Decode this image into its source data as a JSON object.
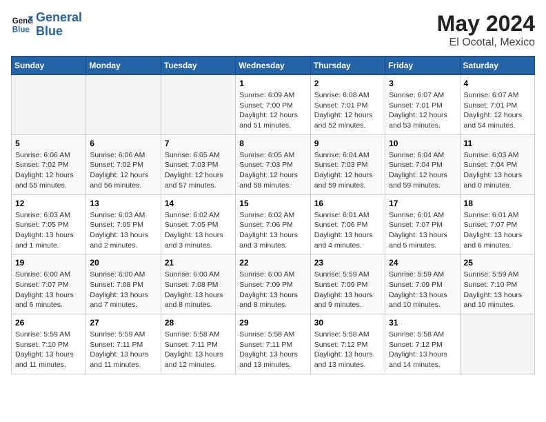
{
  "header": {
    "logo_line1": "General",
    "logo_line2": "Blue",
    "month_year": "May 2024",
    "location": "El Ocotal, Mexico"
  },
  "weekdays": [
    "Sunday",
    "Monday",
    "Tuesday",
    "Wednesday",
    "Thursday",
    "Friday",
    "Saturday"
  ],
  "weeks": [
    [
      {
        "day": "",
        "sunrise": "",
        "sunset": "",
        "daylight": ""
      },
      {
        "day": "",
        "sunrise": "",
        "sunset": "",
        "daylight": ""
      },
      {
        "day": "",
        "sunrise": "",
        "sunset": "",
        "daylight": ""
      },
      {
        "day": "1",
        "sunrise": "Sunrise: 6:09 AM",
        "sunset": "Sunset: 7:00 PM",
        "daylight": "Daylight: 12 hours and 51 minutes."
      },
      {
        "day": "2",
        "sunrise": "Sunrise: 6:08 AM",
        "sunset": "Sunset: 7:01 PM",
        "daylight": "Daylight: 12 hours and 52 minutes."
      },
      {
        "day": "3",
        "sunrise": "Sunrise: 6:07 AM",
        "sunset": "Sunset: 7:01 PM",
        "daylight": "Daylight: 12 hours and 53 minutes."
      },
      {
        "day": "4",
        "sunrise": "Sunrise: 6:07 AM",
        "sunset": "Sunset: 7:01 PM",
        "daylight": "Daylight: 12 hours and 54 minutes."
      }
    ],
    [
      {
        "day": "5",
        "sunrise": "Sunrise: 6:06 AM",
        "sunset": "Sunset: 7:02 PM",
        "daylight": "Daylight: 12 hours and 55 minutes."
      },
      {
        "day": "6",
        "sunrise": "Sunrise: 6:06 AM",
        "sunset": "Sunset: 7:02 PM",
        "daylight": "Daylight: 12 hours and 56 minutes."
      },
      {
        "day": "7",
        "sunrise": "Sunrise: 6:05 AM",
        "sunset": "Sunset: 7:03 PM",
        "daylight": "Daylight: 12 hours and 57 minutes."
      },
      {
        "day": "8",
        "sunrise": "Sunrise: 6:05 AM",
        "sunset": "Sunset: 7:03 PM",
        "daylight": "Daylight: 12 hours and 58 minutes."
      },
      {
        "day": "9",
        "sunrise": "Sunrise: 6:04 AM",
        "sunset": "Sunset: 7:03 PM",
        "daylight": "Daylight: 12 hours and 59 minutes."
      },
      {
        "day": "10",
        "sunrise": "Sunrise: 6:04 AM",
        "sunset": "Sunset: 7:04 PM",
        "daylight": "Daylight: 12 hours and 59 minutes."
      },
      {
        "day": "11",
        "sunrise": "Sunrise: 6:03 AM",
        "sunset": "Sunset: 7:04 PM",
        "daylight": "Daylight: 13 hours and 0 minutes."
      }
    ],
    [
      {
        "day": "12",
        "sunrise": "Sunrise: 6:03 AM",
        "sunset": "Sunset: 7:05 PM",
        "daylight": "Daylight: 13 hours and 1 minute."
      },
      {
        "day": "13",
        "sunrise": "Sunrise: 6:03 AM",
        "sunset": "Sunset: 7:05 PM",
        "daylight": "Daylight: 13 hours and 2 minutes."
      },
      {
        "day": "14",
        "sunrise": "Sunrise: 6:02 AM",
        "sunset": "Sunset: 7:05 PM",
        "daylight": "Daylight: 13 hours and 3 minutes."
      },
      {
        "day": "15",
        "sunrise": "Sunrise: 6:02 AM",
        "sunset": "Sunset: 7:06 PM",
        "daylight": "Daylight: 13 hours and 3 minutes."
      },
      {
        "day": "16",
        "sunrise": "Sunrise: 6:01 AM",
        "sunset": "Sunset: 7:06 PM",
        "daylight": "Daylight: 13 hours and 4 minutes."
      },
      {
        "day": "17",
        "sunrise": "Sunrise: 6:01 AM",
        "sunset": "Sunset: 7:07 PM",
        "daylight": "Daylight: 13 hours and 5 minutes."
      },
      {
        "day": "18",
        "sunrise": "Sunrise: 6:01 AM",
        "sunset": "Sunset: 7:07 PM",
        "daylight": "Daylight: 13 hours and 6 minutes."
      }
    ],
    [
      {
        "day": "19",
        "sunrise": "Sunrise: 6:00 AM",
        "sunset": "Sunset: 7:07 PM",
        "daylight": "Daylight: 13 hours and 6 minutes."
      },
      {
        "day": "20",
        "sunrise": "Sunrise: 6:00 AM",
        "sunset": "Sunset: 7:08 PM",
        "daylight": "Daylight: 13 hours and 7 minutes."
      },
      {
        "day": "21",
        "sunrise": "Sunrise: 6:00 AM",
        "sunset": "Sunset: 7:08 PM",
        "daylight": "Daylight: 13 hours and 8 minutes."
      },
      {
        "day": "22",
        "sunrise": "Sunrise: 6:00 AM",
        "sunset": "Sunset: 7:09 PM",
        "daylight": "Daylight: 13 hours and 8 minutes."
      },
      {
        "day": "23",
        "sunrise": "Sunrise: 5:59 AM",
        "sunset": "Sunset: 7:09 PM",
        "daylight": "Daylight: 13 hours and 9 minutes."
      },
      {
        "day": "24",
        "sunrise": "Sunrise: 5:59 AM",
        "sunset": "Sunset: 7:09 PM",
        "daylight": "Daylight: 13 hours and 10 minutes."
      },
      {
        "day": "25",
        "sunrise": "Sunrise: 5:59 AM",
        "sunset": "Sunset: 7:10 PM",
        "daylight": "Daylight: 13 hours and 10 minutes."
      }
    ],
    [
      {
        "day": "26",
        "sunrise": "Sunrise: 5:59 AM",
        "sunset": "Sunset: 7:10 PM",
        "daylight": "Daylight: 13 hours and 11 minutes."
      },
      {
        "day": "27",
        "sunrise": "Sunrise: 5:59 AM",
        "sunset": "Sunset: 7:11 PM",
        "daylight": "Daylight: 13 hours and 11 minutes."
      },
      {
        "day": "28",
        "sunrise": "Sunrise: 5:58 AM",
        "sunset": "Sunset: 7:11 PM",
        "daylight": "Daylight: 13 hours and 12 minutes."
      },
      {
        "day": "29",
        "sunrise": "Sunrise: 5:58 AM",
        "sunset": "Sunset: 7:11 PM",
        "daylight": "Daylight: 13 hours and 13 minutes."
      },
      {
        "day": "30",
        "sunrise": "Sunrise: 5:58 AM",
        "sunset": "Sunset: 7:12 PM",
        "daylight": "Daylight: 13 hours and 13 minutes."
      },
      {
        "day": "31",
        "sunrise": "Sunrise: 5:58 AM",
        "sunset": "Sunset: 7:12 PM",
        "daylight": "Daylight: 13 hours and 14 minutes."
      },
      {
        "day": "",
        "sunrise": "",
        "sunset": "",
        "daylight": ""
      }
    ]
  ]
}
